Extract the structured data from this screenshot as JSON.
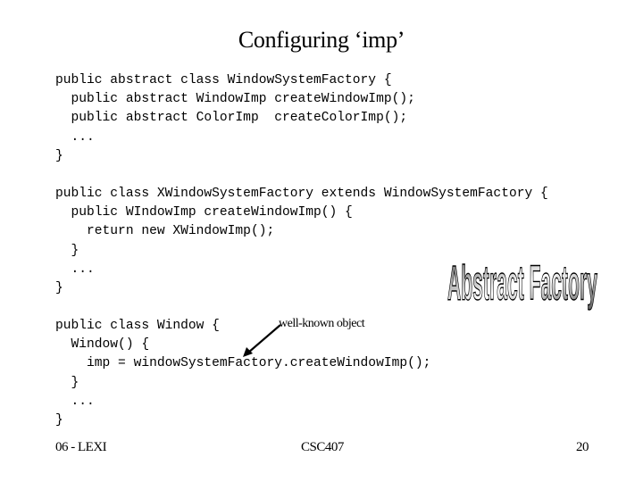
{
  "slide": {
    "title": "Configuring ‘imp’",
    "code_blocks": [
      {
        "lines": [
          "public abstract class WindowSystemFactory {",
          "  public abstract WindowImp createWindowImp();",
          "  public abstract ColorImp  createColorImp();",
          "  ...",
          "}"
        ]
      },
      {
        "lines": [
          "public class XWindowSystemFactory extends WindowSystemFactory {",
          "  public WIndowImp createWindowImp() {",
          "    return new XWindowImp();",
          "  }",
          "  ...",
          "}"
        ]
      },
      {
        "lines": [
          "public class Window {",
          "  Window() {",
          "    imp = windowSystemFactory.createWindowImp();",
          "  }",
          "  ...",
          "}"
        ]
      }
    ],
    "annotation": "well-known object",
    "wordart": {
      "text": "Abstract Factory",
      "gradient_dark": "#555555",
      "gradient_light": "#ffffff",
      "outline": "#000000"
    },
    "footer": {
      "left": "06 - LEXI",
      "center": "CSC407",
      "right": "20"
    }
  }
}
